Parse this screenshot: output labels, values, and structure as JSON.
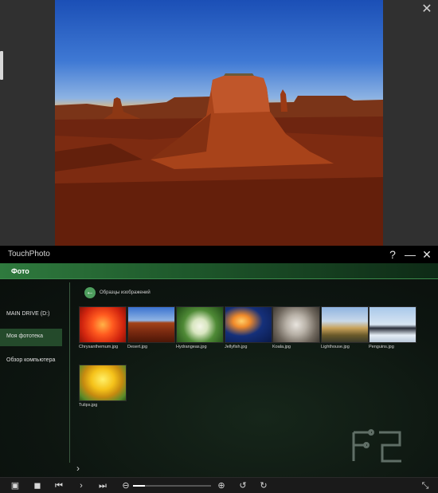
{
  "viewer": {
    "close_icon": "close-icon",
    "photo": "desert-photo"
  },
  "app": {
    "title": "TouchPhoto",
    "help_label": "?",
    "minimize_label": "—",
    "close_label": "✕",
    "tab": "Фото"
  },
  "sidebar": {
    "items": [
      {
        "label": "MAIN DRIVE (D:)",
        "active": false
      },
      {
        "label": "Моя фототека",
        "active": true
      },
      {
        "label": "Обзор компьютера",
        "active": false
      }
    ]
  },
  "folder": {
    "title": "Образцы изображений"
  },
  "thumbnails": [
    {
      "caption": "Chrysanthemum.jpg"
    },
    {
      "caption": "Desert.jpg"
    },
    {
      "caption": "Hydrangeas.jpg"
    },
    {
      "caption": "Jellyfish.jpg"
    },
    {
      "caption": "Koala.jpg"
    },
    {
      "caption": "Lighthouse.jpg"
    },
    {
      "caption": "Penguins.jpg"
    },
    {
      "caption": "Tulips.jpg"
    }
  ],
  "toolbar": {
    "zoom_level": 0.15,
    "icons": [
      "image-icon",
      "stop-icon",
      "first-icon",
      "next-icon",
      "last-icon",
      "zoom-out-icon",
      "zoom-in-icon",
      "rotate-left-icon",
      "rotate-right-icon",
      "fullscreen-icon"
    ]
  },
  "watermark": "FERRA.RU",
  "colors": {
    "accent": "#2f7a3e",
    "active_item": "#244a2b"
  }
}
